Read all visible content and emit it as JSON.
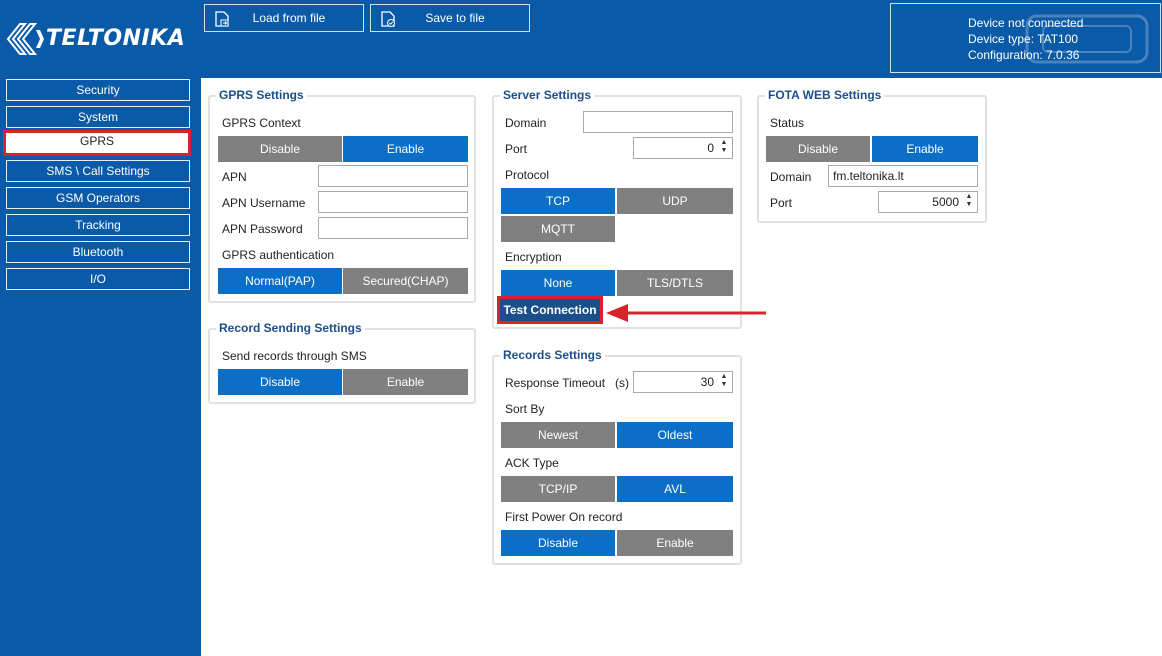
{
  "toolbar": {
    "logo_text": "TELTONIKA",
    "load_label": "Load from file",
    "save_label": "Save to file"
  },
  "device": {
    "status": "Device not connected",
    "type": "Device type: TAT100",
    "configuration": "Configuration: 7.0.36"
  },
  "sidebar": {
    "items": [
      {
        "label": "Security"
      },
      {
        "label": "System"
      },
      {
        "label": "GPRS"
      },
      {
        "label": "SMS \\ Call Settings"
      },
      {
        "label": "GSM Operators"
      },
      {
        "label": "Tracking"
      },
      {
        "label": "Bluetooth"
      },
      {
        "label": "I/O"
      }
    ],
    "active": "GPRS"
  },
  "gprs": {
    "title": "GPRS Settings",
    "context_label": "GPRS Context",
    "context_options": [
      "Disable",
      "Enable"
    ],
    "context_selected": "Enable",
    "apn_label": "APN",
    "apn_value": "",
    "apn_username_label": "APN Username",
    "apn_username_value": "",
    "apn_password_label": "APN Password",
    "apn_password_value": "",
    "auth_label": "GPRS authentication",
    "auth_options": [
      "Normal(PAP)",
      "Secured(CHAP)"
    ],
    "auth_selected": "Normal(PAP)"
  },
  "record_sending": {
    "title": "Record Sending Settings",
    "sms_label": "Send records through SMS",
    "sms_options": [
      "Disable",
      "Enable"
    ],
    "sms_selected": "Disable"
  },
  "server": {
    "title": "Server Settings",
    "domain_label": "Domain",
    "domain_value": "",
    "port_label": "Port",
    "port_value": "0",
    "protocol_label": "Protocol",
    "protocol_options": [
      "TCP",
      "UDP",
      "MQTT"
    ],
    "protocol_selected": "TCP",
    "encryption_label": "Encryption",
    "encryption_options": [
      "None",
      "TLS/DTLS"
    ],
    "encryption_selected": "None",
    "test_button": "Test Connection"
  },
  "records": {
    "title": "Records Settings",
    "timeout_label": "Response Timeout",
    "timeout_unit": "(s)",
    "timeout_value": "30",
    "sort_label": "Sort By",
    "sort_options": [
      "Newest",
      "Oldest"
    ],
    "sort_selected": "Oldest",
    "ack_label": "ACK Type",
    "ack_options": [
      "TCP/IP",
      "AVL"
    ],
    "ack_selected": "AVL",
    "power_label": "First Power On record",
    "power_options": [
      "Disable",
      "Enable"
    ],
    "power_selected": "Disable"
  },
  "fota": {
    "title": "FOTA WEB Settings",
    "status_label": "Status",
    "status_options": [
      "Disable",
      "Enable"
    ],
    "status_selected": "Enable",
    "domain_label": "Domain",
    "domain_value": "fm.teltonika.lt",
    "port_label": "Port",
    "port_value": "5000"
  },
  "colors": {
    "brand_blue": "#0a5aa8",
    "selected_blue": "#0b6fc7",
    "unselected_gray": "#808080",
    "highlight_red": "#d8232a",
    "group_title": "#1b4f8a"
  },
  "icons": {
    "logo": "teltonika-chevron-logo",
    "load": "file-load-icon",
    "save": "file-save-icon",
    "annotation": "red-arrow-icon"
  }
}
